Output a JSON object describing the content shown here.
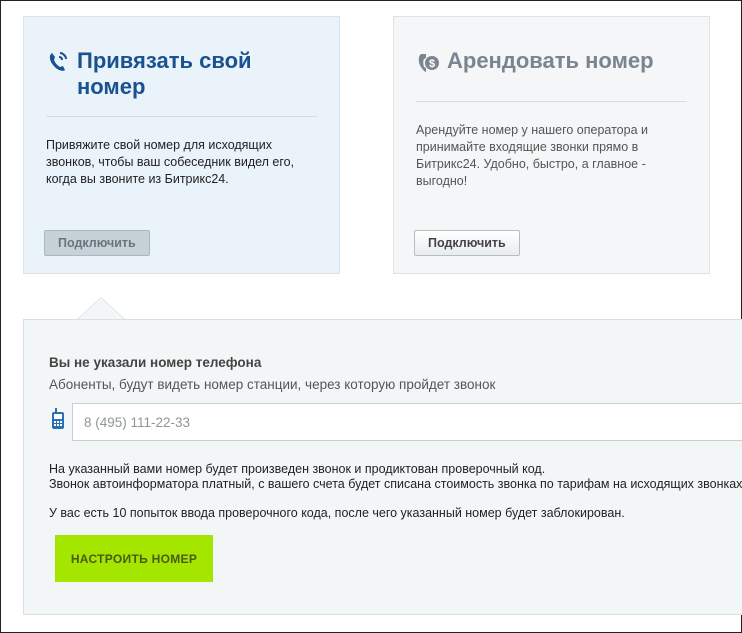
{
  "cards": {
    "bind": {
      "title": "Привязать свой номер",
      "description": "Привяжите свой номер для исходящих звонков, чтобы ваш собеседник видел его, когда вы звоните из Битрикс24.",
      "button_label": "Подключить",
      "icon": "phone-link-icon"
    },
    "rent": {
      "title": "Арендовать номер",
      "description": "Арендуйте номер у нашего оператора и принимайте входящие звонки прямо в Битрикс24. Удобно, быстро, а главное - выгодно!",
      "button_label": "Подключить",
      "icon": "phone-dollar-icon"
    }
  },
  "panel": {
    "title": "Вы не указали номер телефона",
    "subtitle": "Абоненты, будут видеть номер станции, через которую пройдет звонок",
    "phone_placeholder": "8 (495) 111-22-33",
    "phone_value": "",
    "info_line1": "На указанный вами номер будет произведен звонок и продиктован проверочный код.",
    "info_line2": "Звонок автоинформатора платный, с вашего счета будет списана стоимость звонка по тарифам на исходящих звонках.",
    "info_line3": "У вас есть 10 попыток ввода проверочного кода, после чего указанный номер будет заблокирован.",
    "setup_button_label": "НАСТРОИТЬ НОМЕР"
  },
  "colors": {
    "accent_blue": "#1a5290",
    "setup_green": "#a4e600",
    "bind_card_bg": "#eaf2fa",
    "rent_card_bg": "#f4f6f7"
  }
}
